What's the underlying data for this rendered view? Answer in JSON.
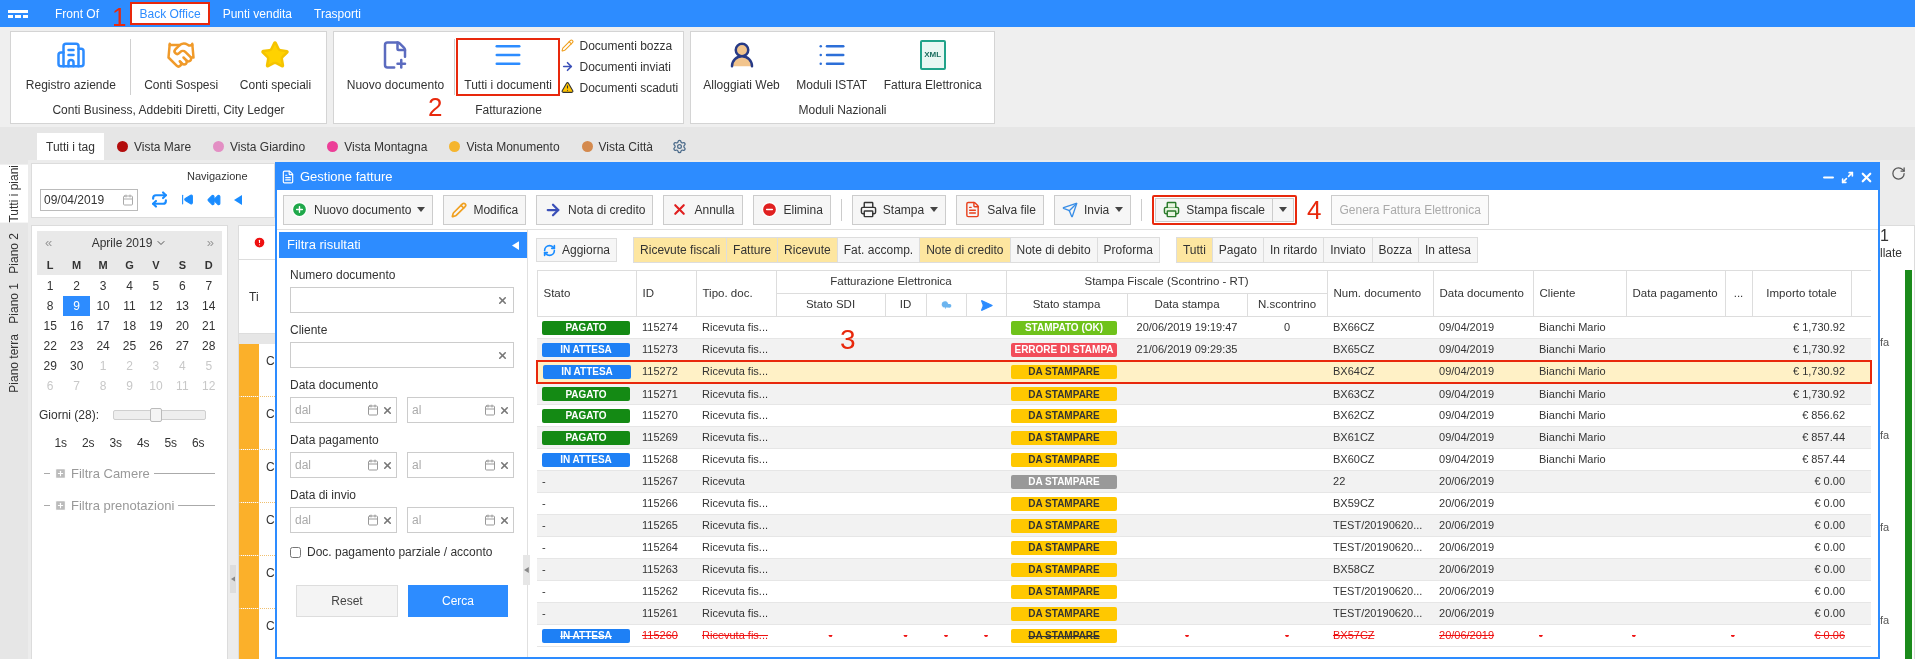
{
  "top_menu": {
    "annotation": "1",
    "items": [
      {
        "label": "Front Of",
        "selected": false,
        "highlighted": false
      },
      {
        "label": "Back Office",
        "selected": true,
        "highlighted": true
      },
      {
        "label": "Punti vendita",
        "selected": false,
        "highlighted": false
      },
      {
        "label": "Trasporti",
        "selected": false,
        "highlighted": false
      }
    ]
  },
  "ribbon": {
    "groups": [
      {
        "caption": "Conti Business, Addebiti Diretti, City Ledger",
        "buttons": [
          {
            "label": "Registro aziende",
            "highlighted": false
          },
          {
            "label": "Conti Sospesi",
            "highlighted": false
          },
          {
            "label": "Conti speciali",
            "highlighted": false
          }
        ]
      },
      {
        "caption": "Fatturazione",
        "annotation": "2",
        "buttons": [
          {
            "label": "Nuovo documento",
            "highlighted": false
          },
          {
            "label": "Tutti i documenti",
            "highlighted": true
          }
        ],
        "links": [
          {
            "label": "Documenti bozza"
          },
          {
            "label": "Documenti inviati"
          },
          {
            "label": "Documenti scaduti"
          }
        ]
      },
      {
        "caption": "Moduli Nazionali",
        "buttons": [
          {
            "label": "Alloggiati Web",
            "highlighted": false
          },
          {
            "label": "Moduli ISTAT",
            "highlighted": false
          },
          {
            "label": "Fattura Elettronica",
            "icon_text": "XML",
            "highlighted": false
          }
        ]
      }
    ]
  },
  "tags": [
    {
      "label": "Tutti i tag",
      "selected": true
    },
    {
      "label": "Vista Mare",
      "selected": false,
      "color": "#b30d0d"
    },
    {
      "label": "Vista Giardino",
      "selected": false,
      "color": "#e38fc4"
    },
    {
      "label": "Vista Montagna",
      "selected": false,
      "color": "#ec3f98"
    },
    {
      "label": "Vista Monumento",
      "selected": false,
      "color": "#f5b52e"
    },
    {
      "label": "Vista Città",
      "selected": false,
      "color": "#d48a4e"
    }
  ],
  "floors": [
    {
      "label": "Tutti i piani",
      "selected": true
    },
    {
      "label": "Piano 2",
      "selected": false
    },
    {
      "label": "Piano 1",
      "selected": false
    },
    {
      "label": "Piano terra",
      "selected": false
    }
  ],
  "navigation": {
    "title": "Navigazione",
    "date": "09/04/2019"
  },
  "calendar": {
    "prev": "«",
    "month": "Aprile 2019",
    "next": "»",
    "weekdays": [
      "L",
      "M",
      "M",
      "G",
      "V",
      "S",
      "D"
    ],
    "weeks": [
      [
        {
          "label": "1",
          "outside": false,
          "selected": false
        },
        {
          "label": "2",
          "outside": false,
          "selected": false
        },
        {
          "label": "3",
          "outside": false,
          "selected": false
        },
        {
          "label": "4",
          "outside": false,
          "selected": false
        },
        {
          "label": "5",
          "outside": false,
          "selected": false
        },
        {
          "label": "6",
          "outside": false,
          "selected": false
        },
        {
          "label": "7",
          "outside": false,
          "selected": false
        }
      ],
      [
        {
          "label": "8",
          "outside": false,
          "selected": false
        },
        {
          "label": "9",
          "outside": false,
          "selected": true
        },
        {
          "label": "10",
          "outside": false,
          "selected": false
        },
        {
          "label": "11",
          "outside": false,
          "selected": false
        },
        {
          "label": "12",
          "outside": false,
          "selected": false
        },
        {
          "label": "13",
          "outside": false,
          "selected": false
        },
        {
          "label": "14",
          "outside": false,
          "selected": false
        }
      ],
      [
        {
          "label": "15",
          "outside": false,
          "selected": false
        },
        {
          "label": "16",
          "outside": false,
          "selected": false
        },
        {
          "label": "17",
          "outside": false,
          "selected": false
        },
        {
          "label": "18",
          "outside": false,
          "selected": false
        },
        {
          "label": "19",
          "outside": false,
          "selected": false
        },
        {
          "label": "20",
          "outside": false,
          "selected": false
        },
        {
          "label": "21",
          "outside": false,
          "selected": false
        }
      ],
      [
        {
          "label": "22",
          "outside": false,
          "selected": false
        },
        {
          "label": "23",
          "outside": false,
          "selected": false
        },
        {
          "label": "24",
          "outside": false,
          "selected": false
        },
        {
          "label": "25",
          "outside": false,
          "selected": false
        },
        {
          "label": "26",
          "outside": false,
          "selected": false
        },
        {
          "label": "27",
          "outside": false,
          "selected": false
        },
        {
          "label": "28",
          "outside": false,
          "selected": false
        }
      ],
      [
        {
          "label": "29",
          "outside": false,
          "selected": false
        },
        {
          "label": "30",
          "outside": false,
          "selected": false
        },
        {
          "label": "1",
          "outside": true,
          "selected": false
        },
        {
          "label": "2",
          "outside": true,
          "selected": false
        },
        {
          "label": "3",
          "outside": true,
          "selected": false
        },
        {
          "label": "4",
          "outside": true,
          "selected": false
        },
        {
          "label": "5",
          "outside": true,
          "selected": false
        }
      ],
      [
        {
          "label": "6",
          "outside": true,
          "selected": false
        },
        {
          "label": "7",
          "outside": true,
          "selected": false
        },
        {
          "label": "8",
          "outside": true,
          "selected": false
        },
        {
          "label": "9",
          "outside": true,
          "selected": false
        },
        {
          "label": "10",
          "outside": true,
          "selected": false
        },
        {
          "label": "11",
          "outside": true,
          "selected": false
        },
        {
          "label": "12",
          "outside": true,
          "selected": false
        }
      ]
    ]
  },
  "days_slider": {
    "label": "Giorni (28):",
    "level": 0.46
  },
  "week_links": [
    "1s",
    "2s",
    "3s",
    "4s",
    "5s",
    "6s"
  ],
  "filters": [
    {
      "label": "Filtra Camere",
      "expanded": false
    },
    {
      "label": "Filtra prenotazioni",
      "expanded": false
    }
  ],
  "background": {
    "header": "Ti",
    "rows": [
      "C",
      "C",
      "C",
      "C",
      "C",
      "C"
    ],
    "side_count": "1",
    "side_label": "llate",
    "side_rows": [
      "fa",
      "fa",
      "fa",
      "fa"
    ]
  },
  "dialog": {
    "title": "Gestione fatture",
    "toolbar": {
      "annotation": "4",
      "buttons": [
        {
          "label": "Nuovo documento",
          "disabled": false,
          "highlighted": false
        },
        {
          "label": "Modifica",
          "disabled": false,
          "highlighted": false
        },
        {
          "label": "Nota di credito",
          "disabled": false,
          "highlighted": false
        },
        {
          "label": "Annulla",
          "disabled": false,
          "highlighted": false
        },
        {
          "label": "Elimina",
          "disabled": false,
          "highlighted": false
        },
        {
          "label": "Stampa",
          "disabled": false,
          "highlighted": false
        },
        {
          "label": "Salva file",
          "disabled": false,
          "highlighted": false
        },
        {
          "label": "Invia",
          "disabled": false,
          "highlighted": false
        },
        {
          "label": "Stampa fiscale",
          "disabled": false,
          "highlighted": true
        },
        {
          "label": "Genera Fattura Elettronica",
          "disabled": true,
          "highlighted": false
        }
      ]
    },
    "filter_panel": {
      "title": "Filtra risultati",
      "fields": [
        {
          "kind": "text",
          "label": "Numero documento"
        },
        {
          "kind": "text",
          "label": "Cliente"
        },
        {
          "kind": "range",
          "label": "Data documento",
          "from_placeholder": "dal",
          "to_placeholder": "al"
        },
        {
          "kind": "range",
          "label": "Data pagamento",
          "from_placeholder": "dal",
          "to_placeholder": "al"
        },
        {
          "kind": "range",
          "label": "Data di invio",
          "from_placeholder": "dal",
          "to_placeholder": "al"
        }
      ],
      "checkbox": {
        "label": "Doc. pagamento parziale / acconto",
        "checked": false
      },
      "buttons": [
        {
          "label": "Reset",
          "kind": "secondary"
        },
        {
          "label": "Cerca",
          "kind": "primary"
        }
      ]
    },
    "results": {
      "refresh": "Aggiorna",
      "annotation": "3",
      "type_filters": [
        {
          "label": "Ricevute fiscali",
          "selected": true
        },
        {
          "label": "Fatture",
          "selected": true
        },
        {
          "label": "Ricevute",
          "selected": true
        },
        {
          "label": "Fat. accomp.",
          "selected": false
        },
        {
          "label": "Note di credito",
          "selected": true
        },
        {
          "label": "Note di debito",
          "selected": false
        },
        {
          "label": "Proforma",
          "selected": false
        }
      ],
      "status_filters": [
        {
          "label": "Tutti",
          "selected": true
        },
        {
          "label": "Pagato",
          "selected": false
        },
        {
          "label": "In ritardo",
          "selected": false
        },
        {
          "label": "Inviato",
          "selected": false
        },
        {
          "label": "Bozza",
          "selected": false
        },
        {
          "label": "In attesa",
          "selected": false
        }
      ],
      "table": {
        "columns": [
          {
            "label": "Stato"
          },
          {
            "label": "ID"
          },
          {
            "label": "Tipo. doc."
          },
          {
            "label": "Fatturazione Elettronica",
            "columns": [
              {
                "label": "Stato SDI",
                "kind": "text"
              },
              {
                "label": "ID",
                "kind": "text"
              },
              {
                "kind": "download"
              },
              {
                "kind": "send"
              }
            ]
          },
          {
            "label": "Stampa Fiscale (Scontrino - RT)",
            "columns": [
              {
                "label": "Stato stampa",
                "kind": "text"
              },
              {
                "label": "Data stampa",
                "kind": "text"
              },
              {
                "label": "N.scontrino",
                "kind": "text"
              }
            ]
          },
          {
            "label": "Num. documento"
          },
          {
            "label": "Data documento"
          },
          {
            "label": "Cliente"
          },
          {
            "label": "Data pagamento"
          },
          {
            "label": "..."
          },
          {
            "label": "Importo totale"
          }
        ],
        "rows": [
          {
            "selected": false,
            "cancelled": false,
            "stato": {
              "text": "PAGATO",
              "kind": "paid"
            },
            "id": "115274",
            "tipo": "Ricevuta fis...",
            "stampa": {
              "text": "STAMPATO (OK)",
              "kind": "printed"
            },
            "data_stampa": "20/06/2019 19:19:47",
            "n_scontrino": "0",
            "num_documento": "BX66CZ",
            "data_documento": "09/04/2019",
            "cliente": "Bianchi Mario",
            "importo": "€ 1,730.92"
          },
          {
            "selected": false,
            "cancelled": false,
            "stato": {
              "text": "IN ATTESA",
              "kind": "waiting"
            },
            "id": "115273",
            "tipo": "Ricevuta fis...",
            "stampa": {
              "text": "ERRORE DI STAMPA",
              "kind": "error"
            },
            "data_stampa": "21/06/2019 09:29:35",
            "num_documento": "BX65CZ",
            "data_documento": "09/04/2019",
            "cliente": "Bianchi Mario",
            "importo": "€ 1,730.92"
          },
          {
            "selected": true,
            "cancelled": false,
            "stato": {
              "text": "IN ATTESA",
              "kind": "waiting"
            },
            "id": "115272",
            "tipo": "Ricevuta fis...",
            "stampa": {
              "text": "DA STAMPARE",
              "kind": "pending"
            },
            "num_documento": "BX64CZ",
            "data_documento": "09/04/2019",
            "cliente": "Bianchi Mario",
            "importo": "€ 1,730.92"
          },
          {
            "selected": false,
            "cancelled": false,
            "stato": {
              "text": "PAGATO",
              "kind": "paid"
            },
            "id": "115271",
            "tipo": "Ricevuta fis...",
            "stampa": {
              "text": "DA STAMPARE",
              "kind": "pending"
            },
            "num_documento": "BX63CZ",
            "data_documento": "09/04/2019",
            "cliente": "Bianchi Mario",
            "importo": "€ 1,730.92"
          },
          {
            "selected": false,
            "cancelled": false,
            "stato": {
              "text": "PAGATO",
              "kind": "paid"
            },
            "id": "115270",
            "tipo": "Ricevuta fis...",
            "stampa": {
              "text": "DA STAMPARE",
              "kind": "pending"
            },
            "num_documento": "BX62CZ",
            "data_documento": "09/04/2019",
            "cliente": "Bianchi Mario",
            "importo": "€ 856.62"
          },
          {
            "selected": false,
            "cancelled": false,
            "stato": {
              "text": "PAGATO",
              "kind": "paid"
            },
            "id": "115269",
            "tipo": "Ricevuta fis...",
            "stampa": {
              "text": "DA STAMPARE",
              "kind": "pending"
            },
            "num_documento": "BX61CZ",
            "data_documento": "09/04/2019",
            "cliente": "Bianchi Mario",
            "importo": "€ 857.44"
          },
          {
            "selected": false,
            "cancelled": false,
            "stato": {
              "text": "IN ATTESA",
              "kind": "waiting"
            },
            "id": "115268",
            "tipo": "Ricevuta fis...",
            "stampa": {
              "text": "DA STAMPARE",
              "kind": "pending"
            },
            "num_documento": "BX60CZ",
            "data_documento": "09/04/2019",
            "cliente": "Bianchi Mario",
            "importo": "€ 857.44"
          },
          {
            "selected": false,
            "cancelled": false,
            "stato": {
              "text": "-",
              "kind": "none"
            },
            "id": "115267",
            "tipo": "Ricevuta",
            "stampa": {
              "text": "DA STAMPARE",
              "kind": "inactive"
            },
            "num_documento": "22",
            "data_documento": "20/06/2019",
            "importo": "€ 0.00"
          },
          {
            "selected": false,
            "cancelled": false,
            "stato": {
              "text": "-",
              "kind": "none"
            },
            "id": "115266",
            "tipo": "Ricevuta fis...",
            "stampa": {
              "text": "DA STAMPARE",
              "kind": "pending"
            },
            "num_documento": "BX59CZ",
            "data_documento": "20/06/2019",
            "importo": "€ 0.00"
          },
          {
            "selected": false,
            "cancelled": false,
            "stato": {
              "text": "-",
              "kind": "none"
            },
            "id": "115265",
            "tipo": "Ricevuta fis...",
            "stampa": {
              "text": "DA STAMPARE",
              "kind": "pending"
            },
            "num_documento": "TEST/20190620...",
            "data_documento": "20/06/2019",
            "importo": "€ 0.00"
          },
          {
            "selected": false,
            "cancelled": false,
            "stato": {
              "text": "-",
              "kind": "none"
            },
            "id": "115264",
            "tipo": "Ricevuta fis...",
            "stampa": {
              "text": "DA STAMPARE",
              "kind": "pending"
            },
            "num_documento": "TEST/20190620...",
            "data_documento": "20/06/2019",
            "importo": "€ 0.00"
          },
          {
            "selected": false,
            "cancelled": false,
            "stato": {
              "text": "-",
              "kind": "none"
            },
            "id": "115263",
            "tipo": "Ricevuta fis...",
            "stampa": {
              "text": "DA STAMPARE",
              "kind": "pending"
            },
            "num_documento": "BX58CZ",
            "data_documento": "20/06/2019",
            "importo": "€ 0.00"
          },
          {
            "selected": false,
            "cancelled": false,
            "stato": {
              "text": "-",
              "kind": "none"
            },
            "id": "115262",
            "tipo": "Ricevuta fis...",
            "stampa": {
              "text": "DA STAMPARE",
              "kind": "pending"
            },
            "num_documento": "TEST/20190620...",
            "data_documento": "20/06/2019",
            "importo": "€ 0.00"
          },
          {
            "selected": false,
            "cancelled": false,
            "stato": {
              "text": "-",
              "kind": "none"
            },
            "id": "115261",
            "tipo": "Ricevuta fis...",
            "stampa": {
              "text": "DA STAMPARE",
              "kind": "pending"
            },
            "num_documento": "TEST/20190620...",
            "data_documento": "20/06/2019",
            "importo": "€ 0.00"
          },
          {
            "selected": false,
            "cancelled": true,
            "stato": {
              "text": "IN ATTESA",
              "kind": "waiting"
            },
            "id": "115260",
            "tipo": "Ricevuta fis...",
            "sdi_stato": "-",
            "sdi_id": "-",
            "sdi_download": "-",
            "sdi_send": "-",
            "stampa": {
              "text": "DA STAMPARE",
              "kind": "pending"
            },
            "data_stampa": "-",
            "n_scontrino": "-",
            "num_documento": "BX57CZ",
            "data_documento": "20/06/2019",
            "cliente": "-",
            "data_pagamento": "-",
            "extra": "-",
            "importo": "€ 0.06"
          }
        ]
      }
    }
  }
}
